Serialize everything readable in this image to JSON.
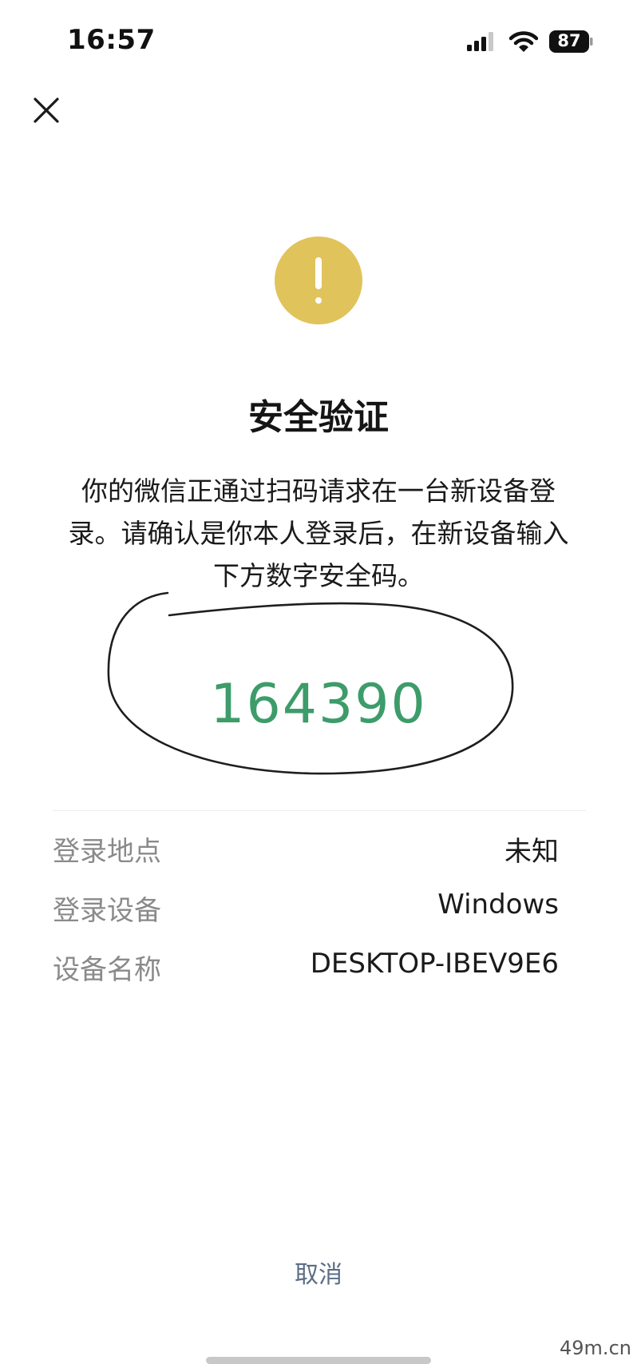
{
  "status_bar": {
    "time": "16:57",
    "battery": "87",
    "icons": [
      "signal-icon",
      "wifi-icon",
      "battery-icon"
    ]
  },
  "header": {
    "close_icon": "close-icon"
  },
  "warning": {
    "icon": "exclamation-icon",
    "color": "#e1c35b"
  },
  "title": "安全验证",
  "description": "你的微信正通过扫码请求在一台新设备登录。请确认是你本人登录后，在新设备输入下方数字安全码。",
  "security_code": "164390",
  "security_code_color": "#3d9c6a",
  "annotation": "hand-drawn-circle",
  "details": [
    {
      "label": "登录地点",
      "value": "未知"
    },
    {
      "label": "登录设备",
      "value": "Windows"
    },
    {
      "label": "设备名称",
      "value": "DESKTOP-IBEV9E6"
    }
  ],
  "cancel_label": "取消",
  "watermark": "49m.cn"
}
